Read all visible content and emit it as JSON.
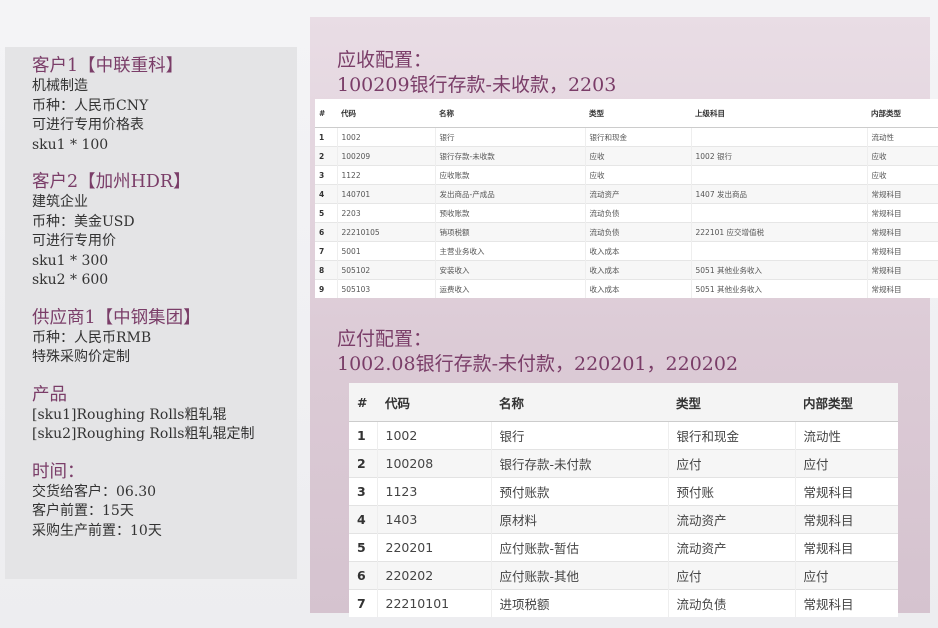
{
  "left": {
    "blocks": [
      {
        "title": "客户1【中联重科】",
        "lines": [
          "机械制造",
          "币种：人民币CNY",
          "可进行专用价格表",
          "sku1 * 100"
        ]
      },
      {
        "title": "客户2【加州HDR】",
        "lines": [
          "建筑企业",
          "币种：美金USD",
          "可进行专用价",
          "sku1 * 300",
          "sku2 * 600"
        ]
      },
      {
        "title": "供应商1【中钢集团】",
        "lines": [
          "币种：人民币RMB",
          "特殊采购价定制"
        ]
      },
      {
        "title": "产品",
        "lines": [
          "[sku1]Roughing Rolls粗轧辊",
          "[sku2]Roughing Rolls粗轧辊定制"
        ]
      },
      {
        "title": "时间：",
        "lines": [
          "交货给客户：06.30",
          "客户前置：15天",
          "采购生产前置：10天"
        ]
      }
    ]
  },
  "receivable": {
    "title1": "应收配置：",
    "title2": "100209银行存款-未收款，2203",
    "headers": [
      "#",
      "代码",
      "名称",
      "类型",
      "上级科目",
      "内部类型"
    ],
    "rows": [
      [
        "1",
        "1002",
        "银行",
        "银行和现金",
        "",
        "流动性"
      ],
      [
        "2",
        "100209",
        "银行存款-未收款",
        "应收",
        "1002 银行",
        "应收"
      ],
      [
        "3",
        "1122",
        "应收账款",
        "应收",
        "",
        "应收"
      ],
      [
        "4",
        "140701",
        "发出商品-产成品",
        "流动资产",
        "1407 发出商品",
        "常规科目"
      ],
      [
        "5",
        "2203",
        "预收账款",
        "流动负债",
        "",
        "常规科目"
      ],
      [
        "6",
        "22210105",
        "销项税额",
        "流动负债",
        "222101 应交增值税",
        "常规科目"
      ],
      [
        "7",
        "5001",
        "主营业务收入",
        "收入成本",
        "",
        "常规科目"
      ],
      [
        "8",
        "505102",
        "安装收入",
        "收入成本",
        "5051 其他业务收入",
        "常规科目"
      ],
      [
        "9",
        "505103",
        "运费收入",
        "收入成本",
        "5051 其他业务收入",
        "常规科目"
      ]
    ]
  },
  "payable": {
    "title1": "应付配置：",
    "title2": "1002.08银行存款-未付款，220201，220202",
    "headers": [
      "#",
      "代码",
      "名称",
      "类型",
      "内部类型"
    ],
    "rows": [
      [
        "1",
        "1002",
        "银行",
        "银行和现金",
        "流动性"
      ],
      [
        "2",
        "100208",
        "银行存款-未付款",
        "应付",
        "应付"
      ],
      [
        "3",
        "1123",
        "预付账款",
        "预付账",
        "常规科目"
      ],
      [
        "4",
        "1403",
        "原材料",
        "流动资产",
        "常规科目"
      ],
      [
        "5",
        "220201",
        "应付账款-暂估",
        "流动资产",
        "常规科目"
      ],
      [
        "6",
        "220202",
        "应付账款-其他",
        "应付",
        "应付"
      ],
      [
        "7",
        "22210101",
        "进项税额",
        "流动负债",
        "常规科目"
      ]
    ]
  }
}
